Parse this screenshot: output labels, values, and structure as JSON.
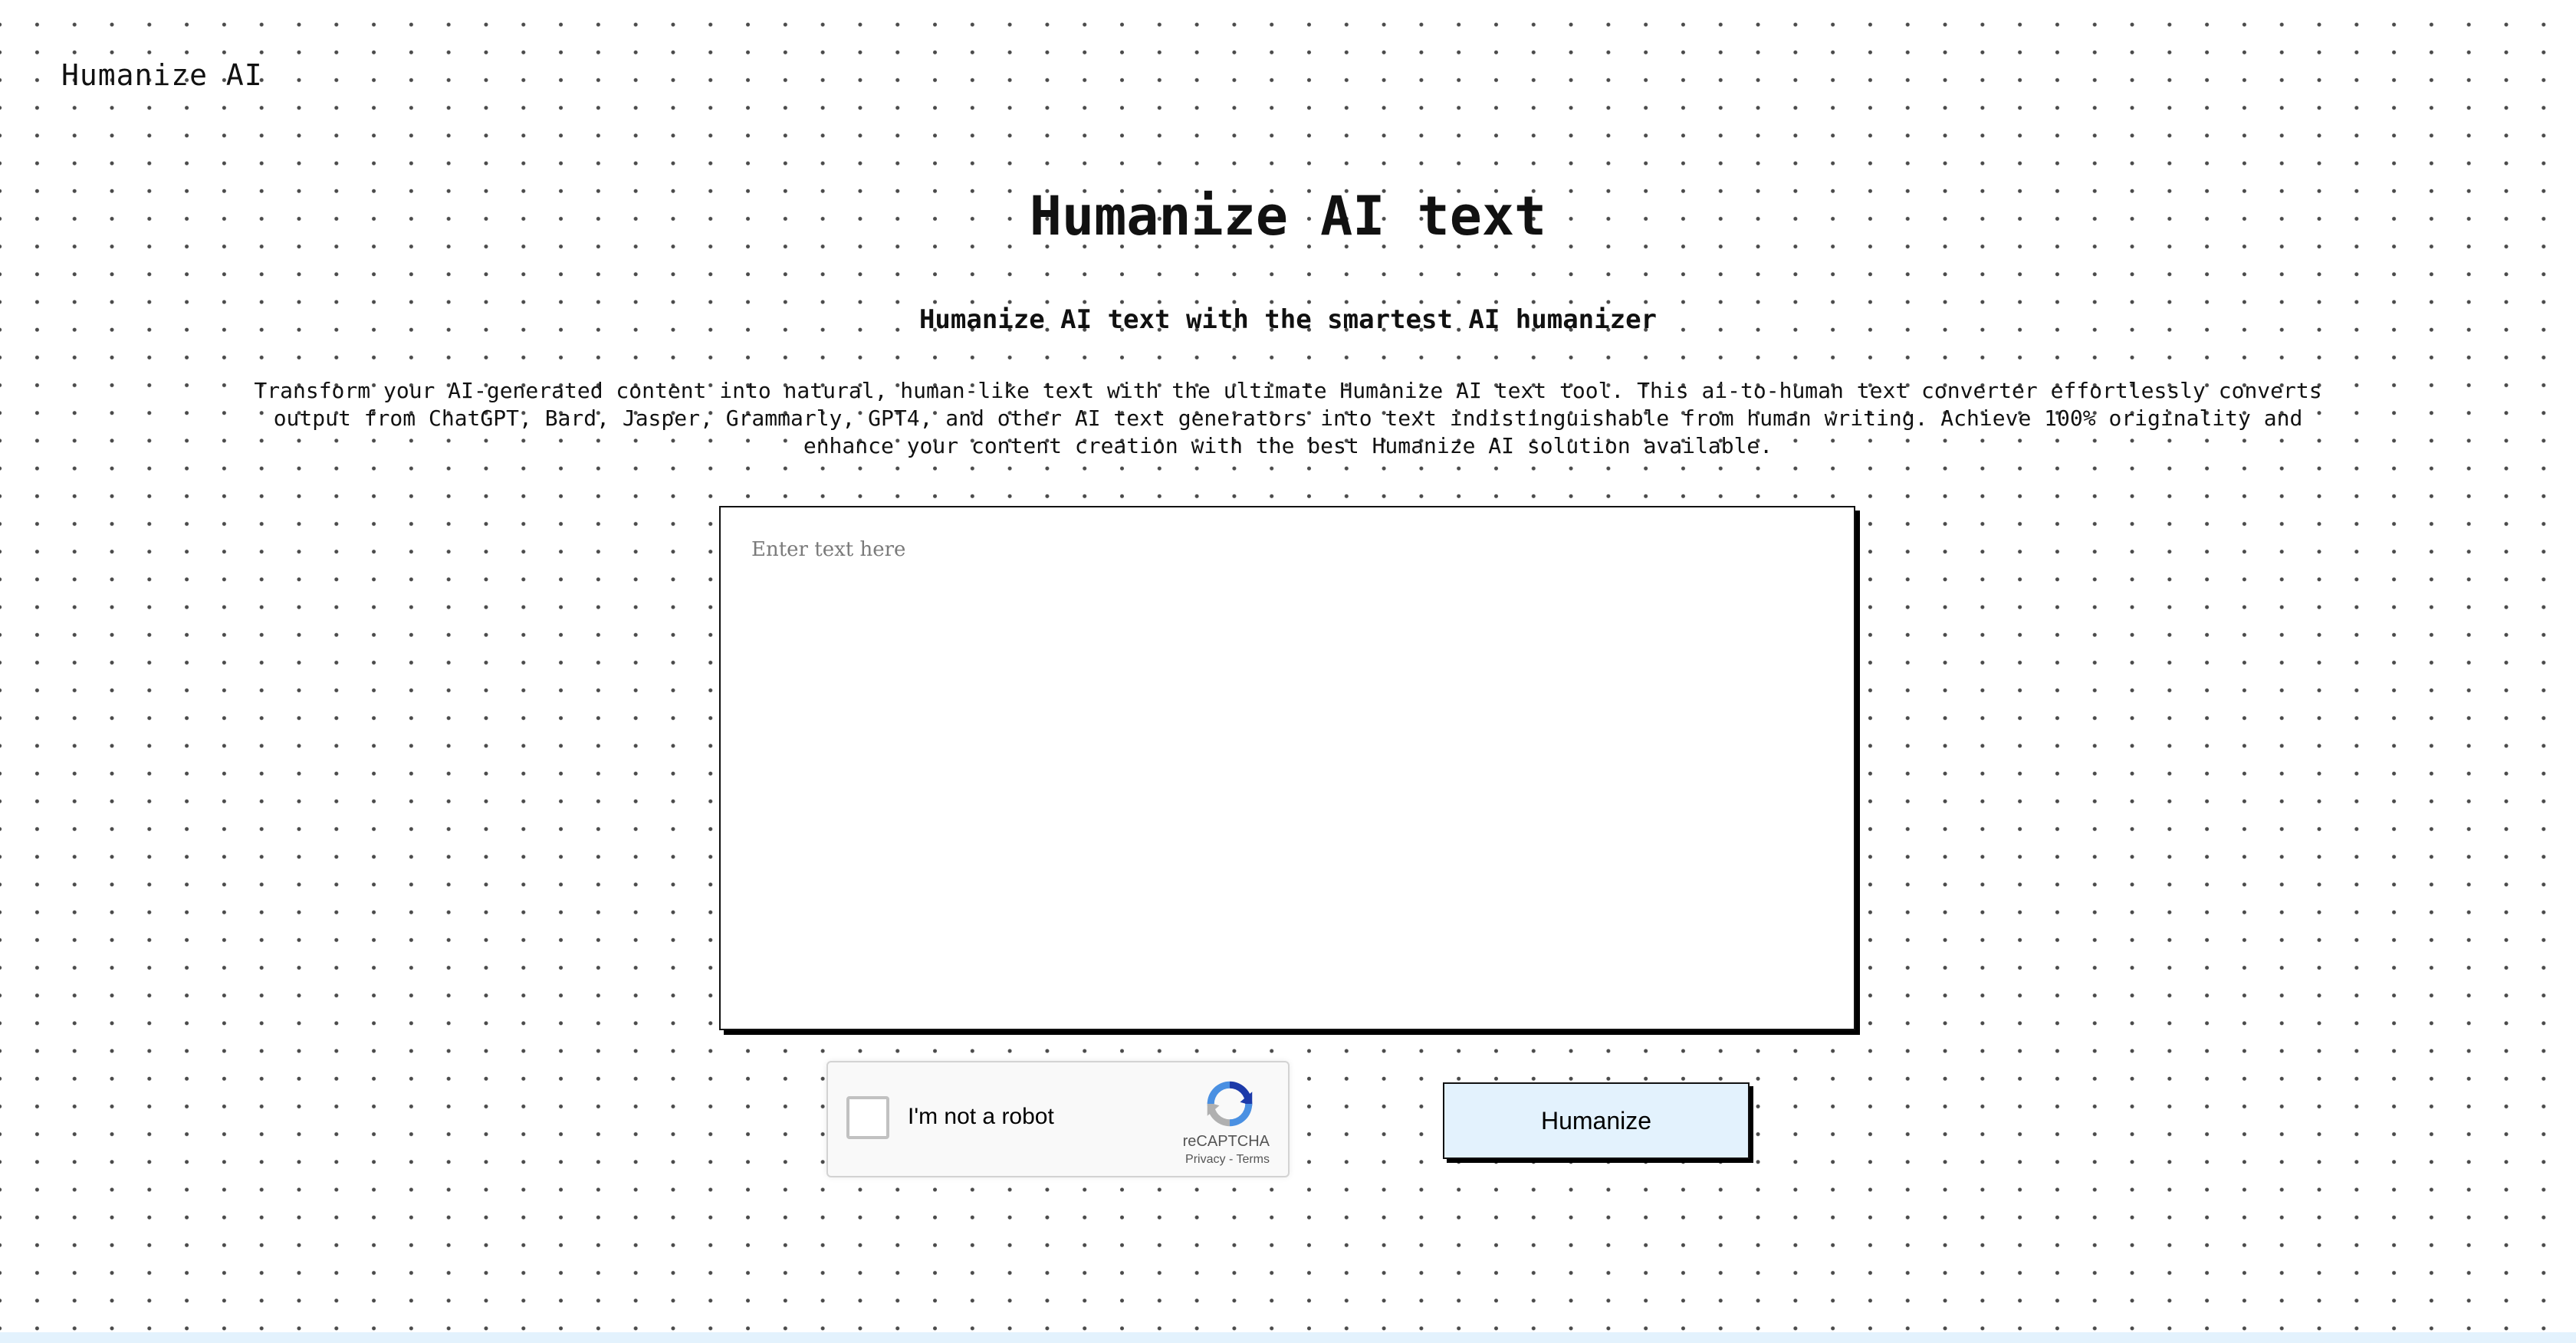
{
  "header": {
    "brand": "Humanize AI"
  },
  "main": {
    "title": "Humanize AI text",
    "subtitle": "Humanize AI text with the smartest AI humanizer",
    "description": "Transform your AI-generated content into natural, human-like text with the ultimate Humanize AI text tool. This ai-to-human text converter effortlessly converts output from ChatGPT, Bard, Jasper, Grammarly, GPT4, and other AI text generators into text indistinguishable from human writing. Achieve 100% originality and enhance your content creation with the best Humanize AI solution available.",
    "input": {
      "placeholder": "Enter text here",
      "value": ""
    }
  },
  "recaptcha": {
    "label": "I'm not a robot",
    "brand": "reCAPTCHA",
    "privacy": "Privacy",
    "separator": " - ",
    "terms": "Terms",
    "checked": false,
    "icon": "recaptcha-logo-icon"
  },
  "actions": {
    "humanize_label": "Humanize"
  },
  "colors": {
    "button_bg": "#e3f2fd",
    "recaptcha_blue": "#1c3aa9",
    "recaptcha_lightblue": "#4a90e2",
    "recaptcha_gray": "#b0b0b0"
  }
}
